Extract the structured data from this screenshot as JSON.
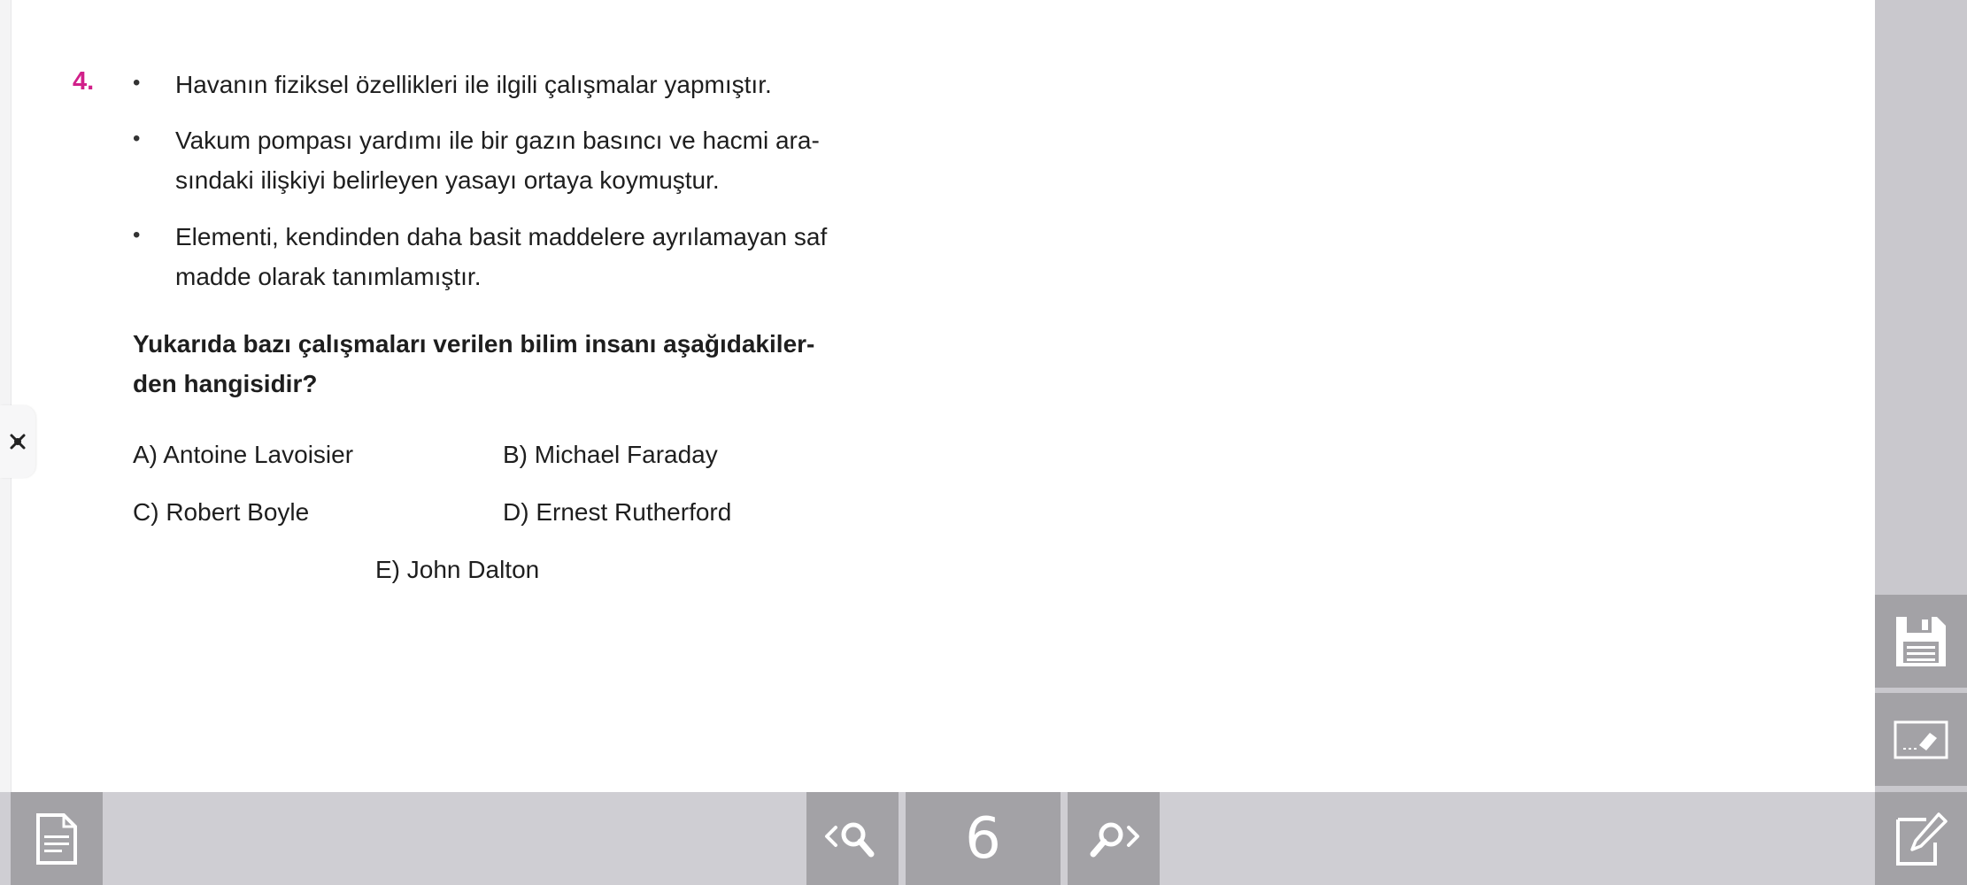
{
  "question": {
    "number": "4.",
    "bullets": [
      {
        "marker": "•",
        "text": "Havanın fiziksel özellikleri ile ilgili çalışmalar yapmıştır."
      },
      {
        "marker": "•",
        "line1": "Vakum pompası yardımı ile bir gazın basıncı ve hacmi ara-",
        "line2": "sındaki ilişkiyi belirleyen yasayı ortaya koymuştur."
      },
      {
        "marker": "•",
        "line1": "Elementi, kendinden daha basit maddelere ayrılamayan saf",
        "line2": "madde olarak tanımlamıştır."
      }
    ],
    "prompt_line1": "Yukarıda bazı çalışmaları verilen bilim insanı aşağıdakiler-",
    "prompt_line2": "den hangisidir?",
    "options": {
      "a": "A) Antoine Lavoisier",
      "b": "B) Michael Faraday",
      "c": "C) Robert Boyle",
      "d": "D) Ernest Rutherford",
      "e": "E) John Dalton"
    }
  },
  "toolbar": {
    "page_number": "6"
  },
  "icons": {
    "side_handle": "pin-tool-icon",
    "save": "floppy-disk-icon",
    "eraser": "eraser-board-icon",
    "notes": "edit-note-icon",
    "document": "document-icon",
    "search_prev": "search-previous-icon",
    "search_next": "search-next-icon"
  },
  "colors": {
    "question_number": "#d1208a",
    "toolbar_bg": "#cfced3",
    "button_bg": "#a3a2a6",
    "rail_bg": "#c9c8cd"
  }
}
